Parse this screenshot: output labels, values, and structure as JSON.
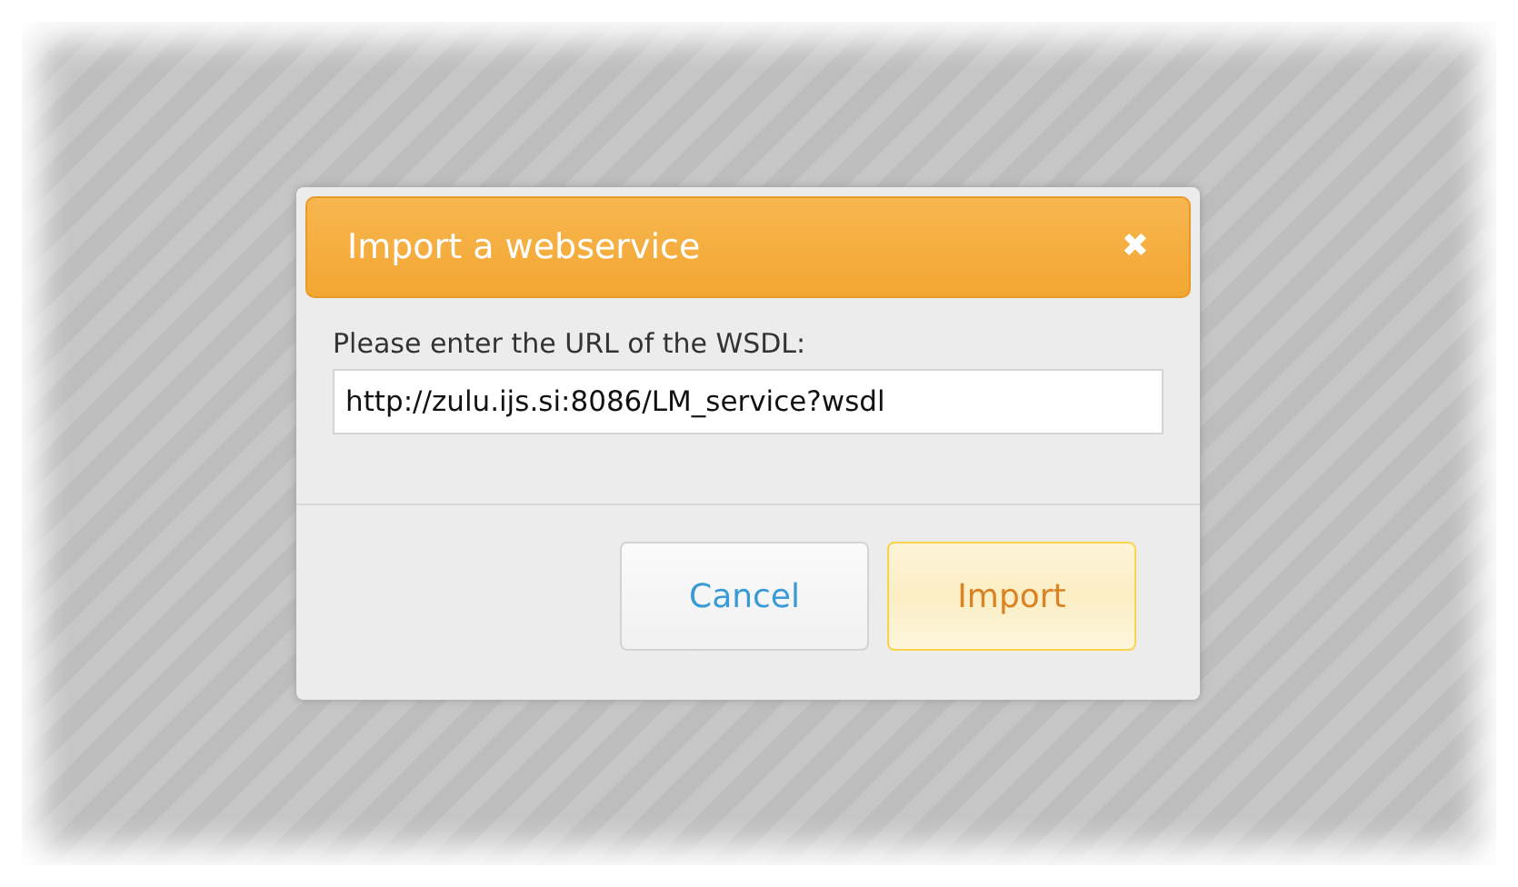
{
  "dialog": {
    "title": "Import a webservice",
    "close": "✖",
    "field": {
      "label": "Please enter the URL of the WSDL:",
      "value": "http://zulu.ijs.si:8086/LM_service?wsdl"
    },
    "buttons": [
      {
        "label": "Cancel",
        "kind": "secondary"
      },
      {
        "label": "Import",
        "kind": "primary"
      }
    ]
  }
}
